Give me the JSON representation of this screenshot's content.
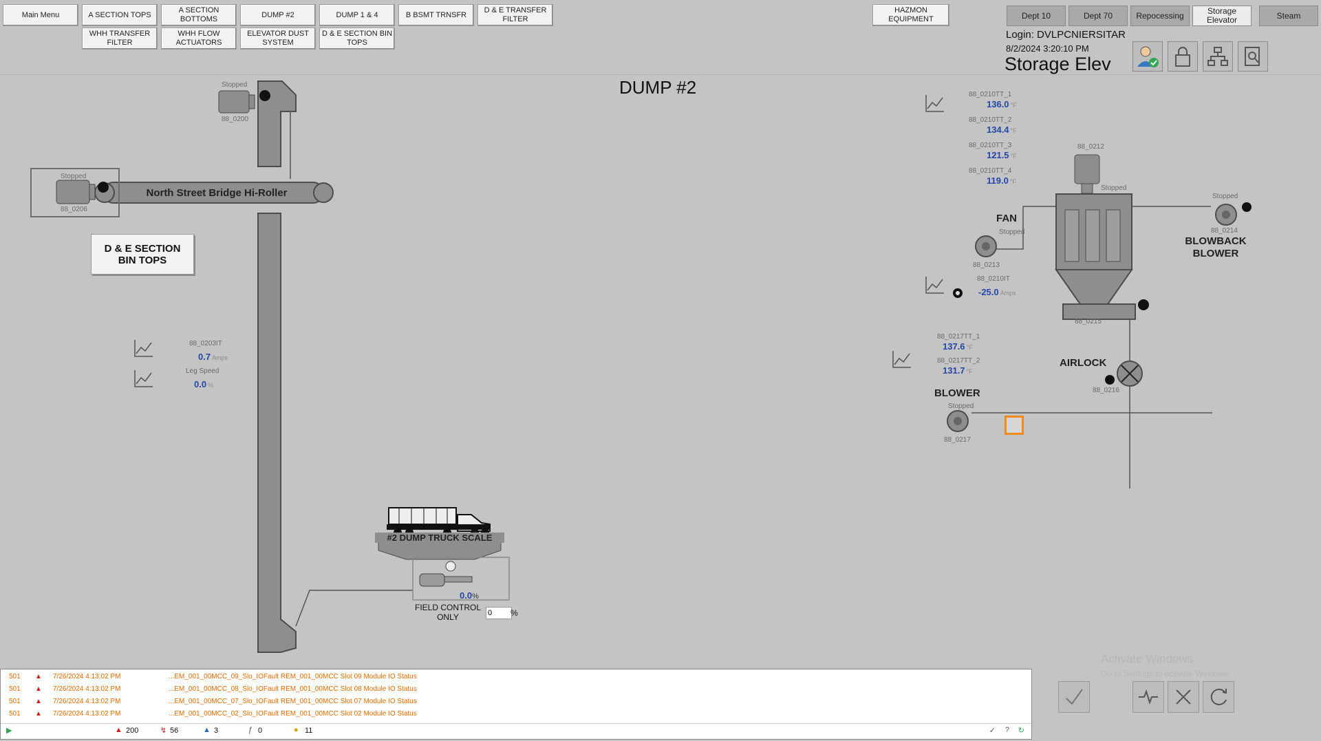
{
  "nav": {
    "row1": [
      "Main Menu",
      "A SECTION TOPS",
      "A SECTION BOTTOMS",
      "DUMP #2",
      "DUMP 1 & 4",
      "B BSMT TRNSFR",
      "D & E TRANSFER FILTER"
    ],
    "row2": [
      "WHH TRANSFER FILTER",
      "WHH FLOW ACTUATORS",
      "ELEVATOR DUST SYSTEM",
      "D & E SECTION BIN TOPS"
    ],
    "hazmon": "HAZMON EQUIPMENT"
  },
  "tabs": [
    "Dept 10",
    "Dept 70",
    "Repocessing",
    "Storage Elevator",
    "Steam"
  ],
  "header": {
    "login": "Login: DVLPCNIERSITAR",
    "datetime": "8/2/2024 3:20:10 PM",
    "area": "Storage Elev",
    "page_title": "DUMP #2"
  },
  "elevator": {
    "motor_top_status": "Stopped",
    "motor_top_tag": "88_0200",
    "conveyor_label": "North Street Bridge Hi-Roller",
    "motor_left_status": "Stopped",
    "motor_left_tag": "88_0206",
    "nav_button": "D & E SECTION BIN TOPS",
    "amps_tag": "88_0203IT",
    "amps_value": "0.7",
    "amps_unit": "Amps",
    "leg_label": "Leg Speed",
    "leg_value": "0.0",
    "leg_unit": "%"
  },
  "truck": {
    "label": "#2 DUMP TRUCK SCALE",
    "valve_value": "0.0",
    "valve_unit": "%",
    "field_label": "FIELD CONTROL ONLY",
    "field_input": "0",
    "field_unit": "%"
  },
  "dust": {
    "temps": [
      {
        "tag": "88_0210TT_1",
        "value": "136.0",
        "unit": "°F"
      },
      {
        "tag": "88_0210TT_2",
        "value": "134.4",
        "unit": "°F"
      },
      {
        "tag": "88_0210TT_3",
        "value": "121.5",
        "unit": "°F"
      },
      {
        "tag": "88_0210TT_4",
        "value": "119.0",
        "unit": "°F"
      }
    ],
    "collector_motor_tag": "88_0212",
    "collector_status": "Stopped",
    "fan_label": "FAN",
    "fan_status": "Stopped",
    "fan_tag": "88_0213",
    "fan_amps_tag": "88_0210IT",
    "fan_amps_value": "-25.0",
    "fan_amps_unit": "Amps",
    "blowback_status": "Stopped",
    "blowback_tag": "88_0214",
    "blowback_label": "BLOWBACK BLOWER",
    "screw_tag": "88_0215",
    "airlock_label": "AIRLOCK",
    "airlock_tag": "88_0216",
    "blower_temps": [
      {
        "tag": "88_0217TT_1",
        "value": "137.6",
        "unit": "°F"
      },
      {
        "tag": "88_0217TT_2",
        "value": "131.7",
        "unit": "°F"
      }
    ],
    "blower_label": "BLOWER",
    "blower_status": "Stopped",
    "blower_tag": "88_0217"
  },
  "alarms": {
    "rows": [
      {
        "pri": "501",
        "time": "7/26/2024 4:13:02 PM",
        "msg": "...EM_001_00MCC_09_Slo_IOFault REM_001_00MCC Slot 09 Module IO Status"
      },
      {
        "pri": "501",
        "time": "7/26/2024 4:13:02 PM",
        "msg": "...EM_001_00MCC_08_Slo_IOFault REM_001_00MCC Slot 08 Module IO Status"
      },
      {
        "pri": "501",
        "time": "7/26/2024 4:13:02 PM",
        "msg": "...EM_001_00MCC_07_Slo_IOFault REM_001_00MCC Slot 07 Module IO Status"
      },
      {
        "pri": "501",
        "time": "7/26/2024 4:13:02 PM",
        "msg": "...EM_001_00MCC_02_Slo_IOFault REM_001_00MCC Slot 02 Module IO Status"
      }
    ],
    "counts": {
      "active": "200",
      "unack": "56",
      "info": "3",
      "shelved": "0",
      "suppressed": "11"
    }
  },
  "watermark": {
    "line1": "Activate Windows",
    "line2": "Go to Settings to activate Windows."
  },
  "colors": {
    "background": "#c4c4c4",
    "value_blue": "#2446a8",
    "alarm_orange": "#e06a00",
    "alarm_red": "#d02020"
  }
}
